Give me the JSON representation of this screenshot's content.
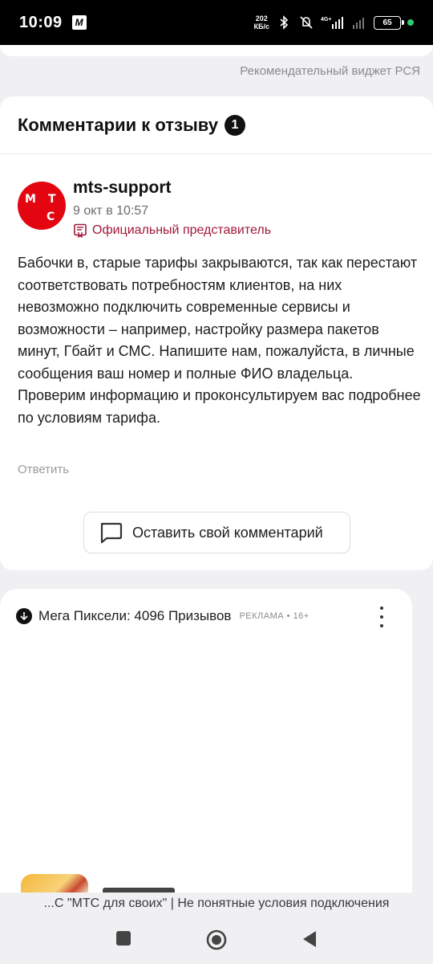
{
  "status_bar": {
    "time": "10:09",
    "app_badge": "M",
    "net_speed_value": "202",
    "net_speed_unit": "КБ/с",
    "network_type": "4G+",
    "battery_level": "65"
  },
  "widget_caption": "Рекомендательный виджет РСЯ",
  "comments": {
    "title": "Комментарии к отзыву",
    "count": "1",
    "items": [
      {
        "avatar_letters": [
          "М",
          "Т",
          "С"
        ],
        "author": "mts-support",
        "date": "9 окт в 10:57",
        "badge": "Официальный представитель",
        "text": "Бабочки в, старые тарифы закрываются, так как перестают соответствовать потребностям клиентов, на них невозможно подключить современные сервисы и возможности – например, настройку размера пакетов минут, Гбайт и СМС. Напишите нам, пожалуйста, в личные сообщения ваш номер и полные ФИО владельца. Проверим информацию и проконсультируем вас подробнее по условиям тарифа.",
        "reply_label": "Ответить"
      }
    ],
    "leave_comment_label": "Оставить свой комментарий"
  },
  "ad": {
    "title": "Мега Пиксели: 4096 Призывов",
    "label": "РЕКЛАМА • 16+"
  },
  "page_title_bar": "...С \"МТС для своих\" | Не понятные условия подключения",
  "colors": {
    "mts_red": "#e30611",
    "official_badge": "#a2193a",
    "background": "#f0f0f3"
  }
}
